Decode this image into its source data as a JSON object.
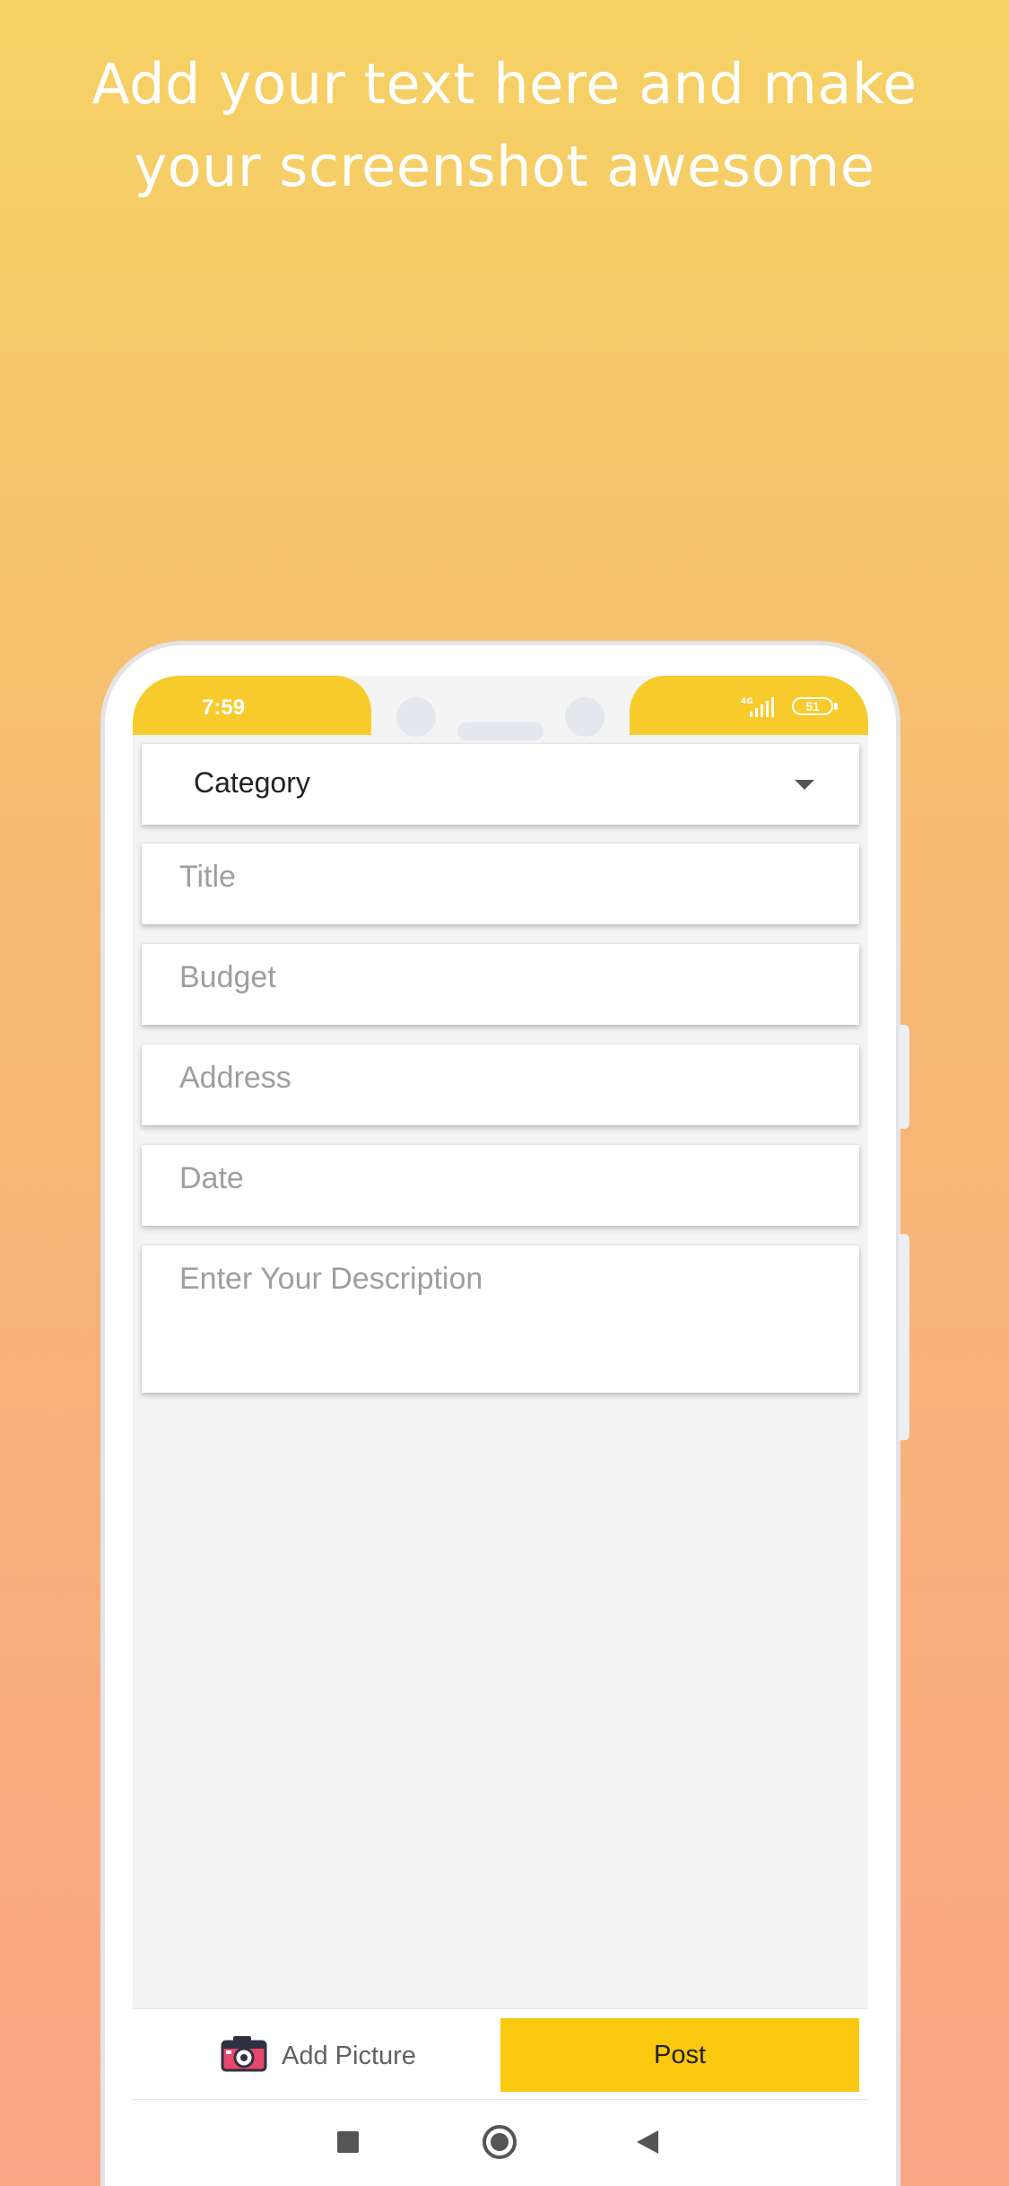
{
  "headline": {
    "line1": "Add your text here and make",
    "line2": "your screenshot awesome"
  },
  "status_bar": {
    "time": "7:59",
    "network": "4G",
    "battery": "51"
  },
  "form": {
    "category_label": "Category",
    "title_placeholder": "Title",
    "budget_placeholder": "Budget",
    "address_placeholder": "Address",
    "date_placeholder": "Date",
    "description_placeholder": "Enter Your Description"
  },
  "actions": {
    "add_picture_label": "Add Picture",
    "post_label": "Post"
  },
  "colors": {
    "accent": "#f9c80f",
    "status_bar": "#f8cb2d",
    "background_top": "#f6d264",
    "background_bottom": "#f9a585"
  },
  "icons": {
    "add_picture": "camera-icon",
    "dropdown": "caret-down-icon",
    "nav_recents": "square-icon",
    "nav_home": "circle-icon",
    "nav_back": "triangle-back-icon"
  }
}
